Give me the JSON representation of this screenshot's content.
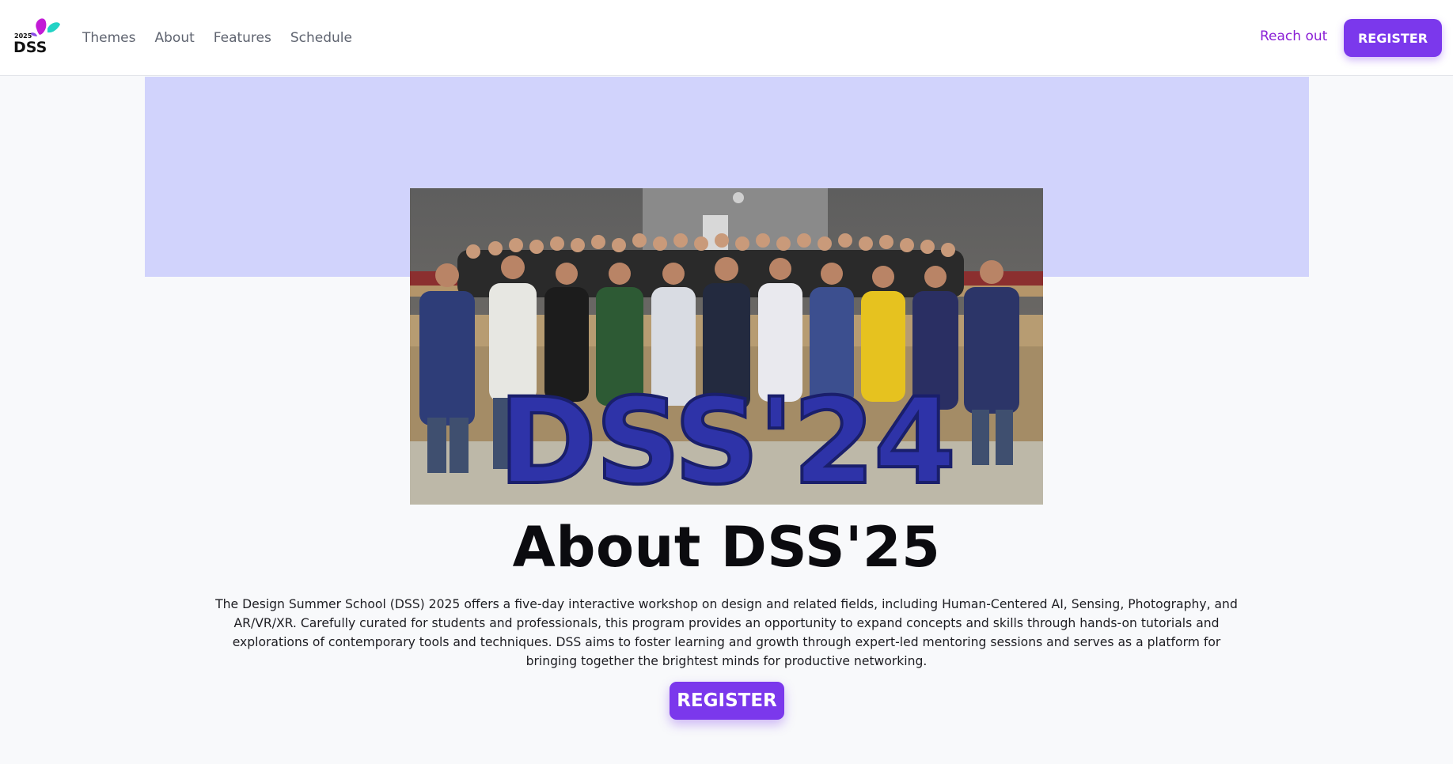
{
  "brand": {
    "logo_year": "2025",
    "logo_text": "DSS",
    "colors": {
      "accent": "#7b38ec",
      "link_accent": "#8a1fd6",
      "hero_band": "#d1d3fc",
      "logo_magenta": "#c21bd6",
      "logo_teal": "#22d3c5"
    }
  },
  "nav": {
    "links": [
      "Themes",
      "About",
      "Features",
      "Schedule"
    ],
    "reach_out": "Reach out",
    "register": "REGISTER"
  },
  "hero": {
    "photo_sign": "DSS'24"
  },
  "about": {
    "title": "About DSS'25",
    "paragraph": "The Design Summer School (DSS) 2025 offers a five-day interactive workshop on design and related fields, including Human-Centered AI, Sensing, Photography, and AR/VR/XR. Carefully curated for students and professionals, this program provides an opportunity to expand concepts and skills through hands-on tutorials and explorations of contemporary tools and techniques. DSS aims to foster learning and growth through expert-led mentoring sessions and serves as a platform for bringing together the brightest minds for productive networking.",
    "register": "REGISTER"
  }
}
